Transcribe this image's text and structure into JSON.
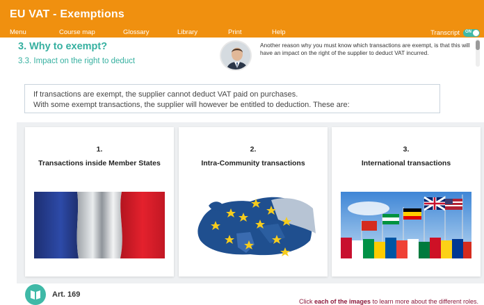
{
  "app": {
    "title": "EU VAT - Exemptions"
  },
  "menu": {
    "items": [
      "Menu",
      "Course map",
      "Glossary",
      "Library",
      "Print",
      "Help"
    ],
    "transcript_label": "Transcript",
    "transcript_toggle": "ON"
  },
  "section": {
    "title": "3. Why to exempt?",
    "subtitle": "3.3. Impact on the right to deduct"
  },
  "note": {
    "text": "Another reason why you must know which transactions are exempt, is that this will have an impact on the right of the supplier to deduct VAT incurred."
  },
  "intro": {
    "line1": "If transactions are exempt, the supplier cannot deduct VAT paid on purchases.",
    "line2": "With some exempt transactions, the supplier will however be entitled to deduction. These are:"
  },
  "cards": [
    {
      "number": "1.",
      "label": "Transactions inside Member States",
      "image_icon": "french-flag-image"
    },
    {
      "number": "2.",
      "label": "Intra-Community transactions",
      "image_icon": "eu-map-image"
    },
    {
      "number": "3.",
      "label": "International transactions",
      "image_icon": "international-flags-image"
    }
  ],
  "footer": {
    "article": "Art. 169",
    "instruction_pre": "Click ",
    "instruction_bold": "each of the images",
    "instruction_post": " to learn more about the different roles."
  },
  "colors": {
    "header": "#f0900f",
    "accent": "#36b0a0",
    "instruction": "#8a1538"
  }
}
